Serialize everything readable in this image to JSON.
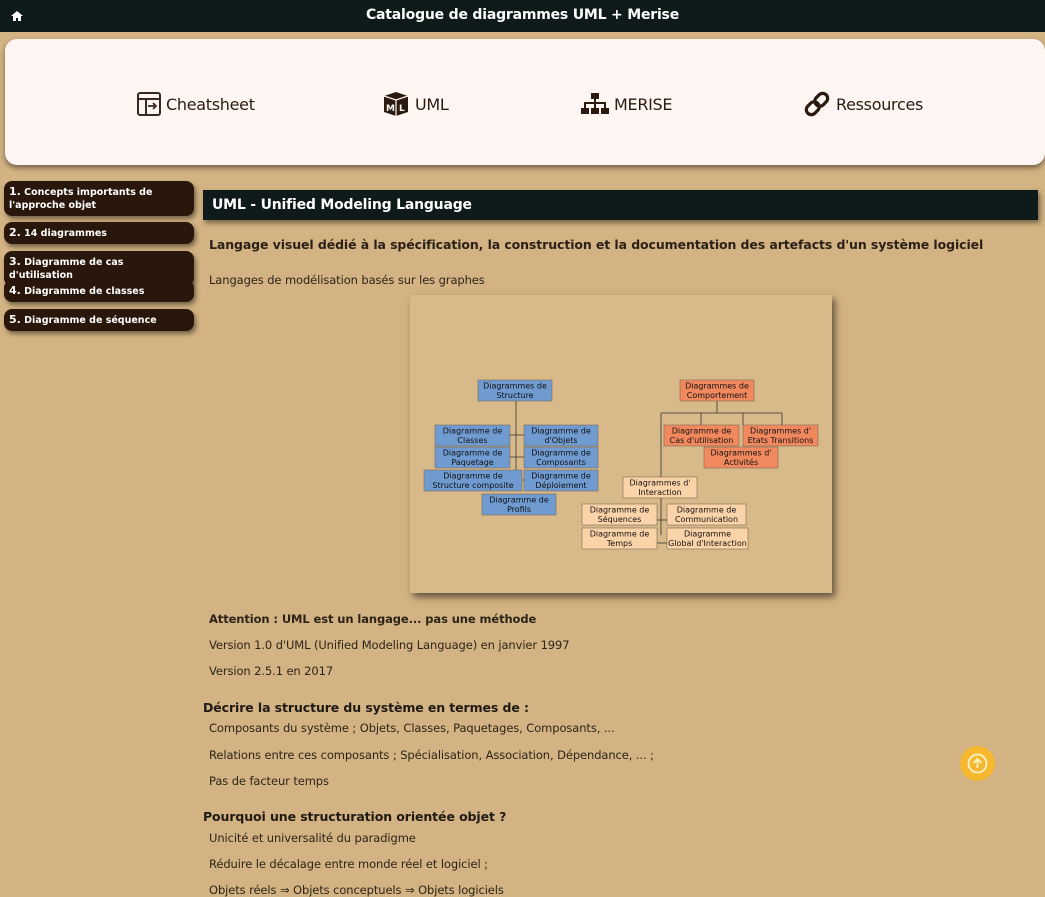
{
  "header": {
    "title": "Catalogue de diagrammes UML + Merise",
    "home_icon": "home-icon"
  },
  "nav": [
    {
      "label": "Cheatsheet",
      "icon": "cheatsheet-icon"
    },
    {
      "label": "UML",
      "icon": "uml-cube-icon"
    },
    {
      "label": "MERISE",
      "icon": "sitemap-icon"
    },
    {
      "label": "Ressources",
      "icon": "link-icon"
    }
  ],
  "sidebar": [
    {
      "num": "1.",
      "label": "Concepts importants de l'approche objet"
    },
    {
      "num": "2.",
      "label": "14 diagrammes"
    },
    {
      "num": "3.",
      "label": "Diagramme de cas d'utilisation"
    },
    {
      "num": "4.",
      "label": "Diagramme de classes"
    },
    {
      "num": "5.",
      "label": "Diagramme de séquence"
    }
  ],
  "main": {
    "section_title": "UML - Unified Modeling Language",
    "lead": "Langage visuel dédié à la spécification, la construction et la documentation des artefacts d'un système logiciel",
    "intro": "Langages de modélisation basés sur les graphes",
    "attention": "Attention : UML est un langage... pas une méthode",
    "version1": "Version 1.0 d'UML (Unified Modeling Language) en janvier 1997",
    "version2": "Version 2.5.1 en 2017",
    "structure_title": "Décrire la structure du système en termes de :",
    "structure_items": [
      "Composants du système ; Objets, Classes, Paquetages, Composants, ...",
      "Relations entre ces composants ; Spécialisation, Association, Dépendance, ... ;",
      "Pas de facteur temps"
    ],
    "why_title": "Pourquoi une structuration orientée objet ?",
    "why_items": [
      "Unicité et universalité du paradigme",
      "Réduire le décalage entre monde réel et logiciel ;",
      "Objets réels ⇒ Objets conceptuels ⇒ Objets logiciels"
    ]
  },
  "diagram": {
    "structure": {
      "root": [
        "Diagrammes de",
        "Structure"
      ],
      "children": [
        [
          "Diagramme de",
          "Classes"
        ],
        [
          "Diagramme de",
          "d'Objets"
        ],
        [
          "Diagramme de",
          "Paquetage"
        ],
        [
          "Diagramme de",
          "Composants"
        ],
        [
          "Diagramme de",
          "Structure composite"
        ],
        [
          "Diagramme de",
          "Déploiement"
        ],
        [
          "Diagramme de",
          "Profils"
        ]
      ]
    },
    "behavior": {
      "root": [
        "Diagrammes de",
        "Comportement"
      ],
      "children": [
        [
          "Diagramme de",
          "Cas d'utilisation"
        ],
        [
          "Diagrammes d'",
          "Etats Transitions"
        ],
        [
          "Diagrammes d'",
          "Activités"
        ],
        [
          "Diagrammes d'",
          "Interaction"
        ],
        [
          "Diagramme de",
          "Séquences"
        ],
        [
          "Diagramme de",
          "Communication"
        ],
        [
          "Diagramme de",
          "Temps"
        ],
        [
          "Diagramme",
          "Global d'Interaction"
        ]
      ]
    },
    "colors": {
      "structure": "#6f9bd1",
      "behavior": "#f2895e",
      "interaction": "#fbd3a8"
    }
  },
  "scroll_top_icon": "arrow-up-icon"
}
